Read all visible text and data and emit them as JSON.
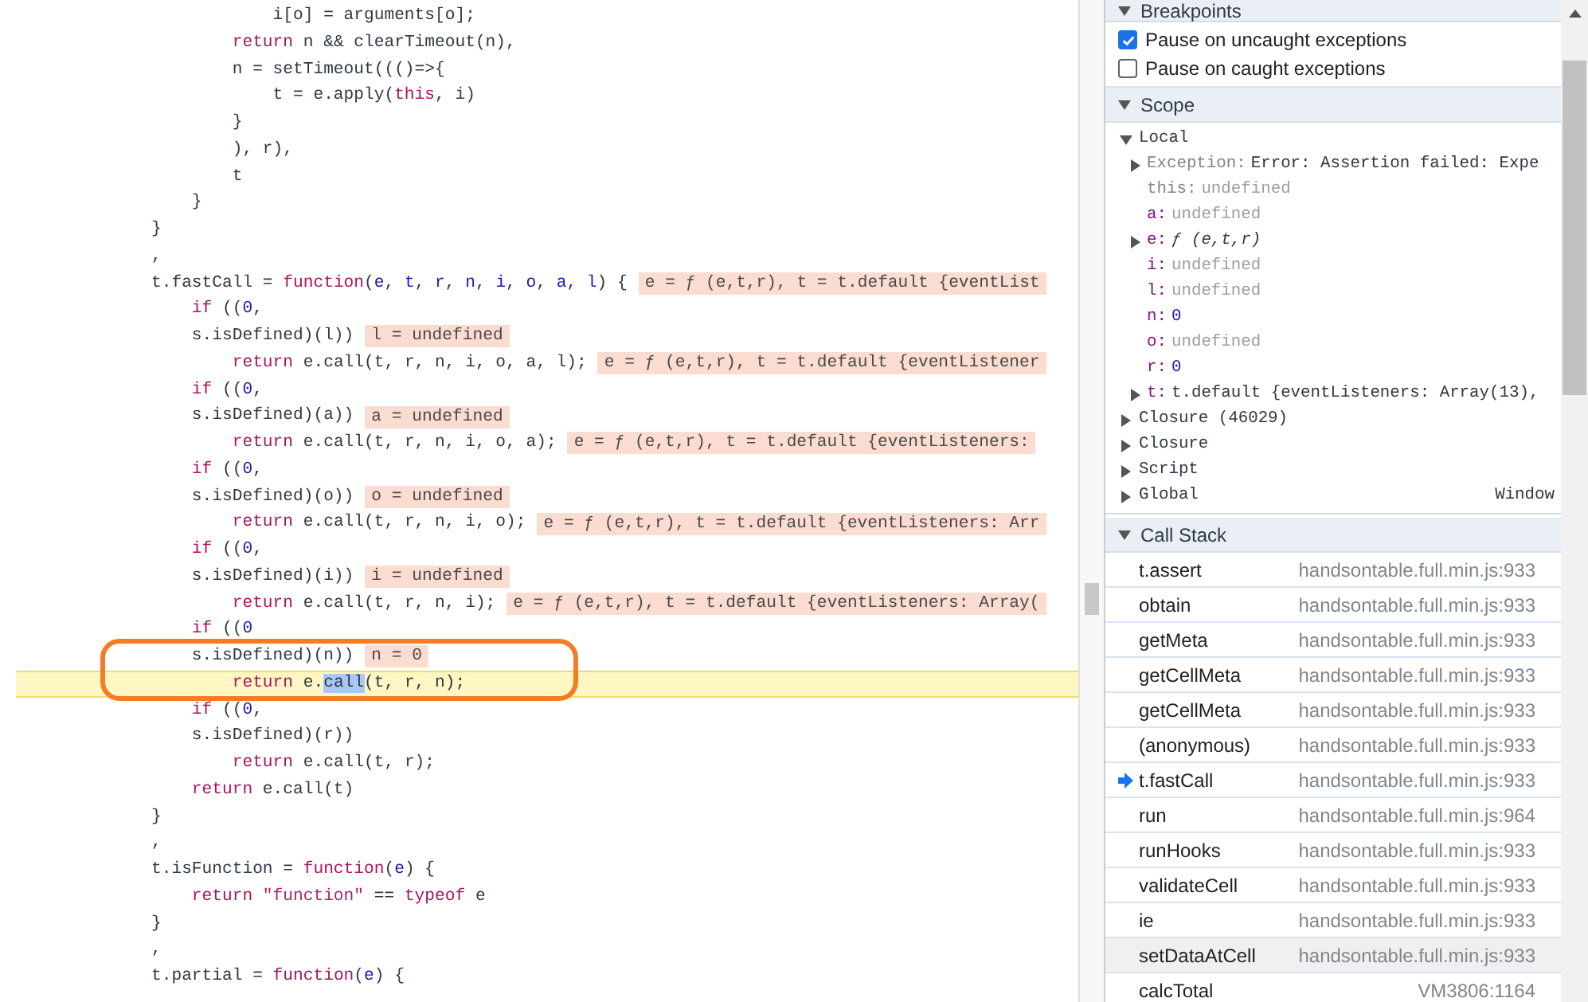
{
  "code": {
    "lines": [
      {
        "segments": [
          {
            "text": "            i[o] = arguments[o];",
            "kind": "plain"
          }
        ]
      },
      {
        "segments": [
          {
            "text": "        return",
            "kind": "keyword"
          },
          {
            "text": " n && clearTimeout(n),",
            "kind": "plain"
          }
        ]
      },
      {
        "segments": [
          {
            "text": "        n = setTimeout((()=>{",
            "kind": "plain"
          }
        ]
      },
      {
        "segments": [
          {
            "text": "            t = e.apply(",
            "kind": "plain"
          },
          {
            "text": "this",
            "kind": "keyword"
          },
          {
            "text": ", i)",
            "kind": "plain"
          }
        ]
      },
      {
        "segments": [
          {
            "text": "        }",
            "kind": "plain"
          }
        ]
      },
      {
        "segments": [
          {
            "text": "        ), r),",
            "kind": "plain"
          }
        ]
      },
      {
        "segments": [
          {
            "text": "        t",
            "kind": "plain"
          }
        ]
      },
      {
        "segments": [
          {
            "text": "    }",
            "kind": "plain"
          }
        ]
      },
      {
        "segments": [
          {
            "text": "}",
            "kind": "plain"
          }
        ]
      },
      {
        "segments": [
          {
            "text": ",",
            "kind": "plain"
          }
        ]
      },
      {
        "segments": [
          {
            "text": "t.fastCall = ",
            "kind": "plain"
          },
          {
            "text": "function",
            "kind": "keyword"
          },
          {
            "text": "(",
            "kind": "plain"
          },
          {
            "text": "e",
            "kind": "param"
          },
          {
            "text": ", ",
            "kind": "plain"
          },
          {
            "text": "t",
            "kind": "param"
          },
          {
            "text": ", ",
            "kind": "plain"
          },
          {
            "text": "r",
            "kind": "param"
          },
          {
            "text": ", ",
            "kind": "plain"
          },
          {
            "text": "n",
            "kind": "param"
          },
          {
            "text": ", ",
            "kind": "plain"
          },
          {
            "text": "i",
            "kind": "param"
          },
          {
            "text": ", ",
            "kind": "plain"
          },
          {
            "text": "o",
            "kind": "param"
          },
          {
            "text": ", ",
            "kind": "plain"
          },
          {
            "text": "a",
            "kind": "param"
          },
          {
            "text": ", ",
            "kind": "plain"
          },
          {
            "text": "l",
            "kind": "param"
          },
          {
            "text": ") {",
            "kind": "plain"
          }
        ],
        "inline_value": "e = ƒ (e,t,r), t = t.default {eventList"
      },
      {
        "segments": [
          {
            "text": "    if",
            "kind": "keyword"
          },
          {
            "text": " ((",
            "kind": "plain"
          },
          {
            "text": "0",
            "kind": "number"
          },
          {
            "text": ",",
            "kind": "plain"
          }
        ]
      },
      {
        "segments": [
          {
            "text": "    s.isDefined)(l))",
            "kind": "plain"
          }
        ],
        "inline_value": "l = undefined"
      },
      {
        "segments": [
          {
            "text": "        return",
            "kind": "keyword"
          },
          {
            "text": " e.call(t, r, n, i, o, a, l);",
            "kind": "plain"
          }
        ],
        "inline_value": "e = ƒ (e,t,r), t = t.default {eventListener"
      },
      {
        "segments": [
          {
            "text": "    if",
            "kind": "keyword"
          },
          {
            "text": " ((",
            "kind": "plain"
          },
          {
            "text": "0",
            "kind": "number"
          },
          {
            "text": ",",
            "kind": "plain"
          }
        ]
      },
      {
        "segments": [
          {
            "text": "    s.isDefined)(a))",
            "kind": "plain"
          }
        ],
        "inline_value": "a = undefined"
      },
      {
        "segments": [
          {
            "text": "        return",
            "kind": "keyword"
          },
          {
            "text": " e.call(t, r, n, i, o, a);",
            "kind": "plain"
          }
        ],
        "inline_value": "e = ƒ (e,t,r), t = t.default {eventListeners:"
      },
      {
        "segments": [
          {
            "text": "    if",
            "kind": "keyword"
          },
          {
            "text": " ((",
            "kind": "plain"
          },
          {
            "text": "0",
            "kind": "number"
          },
          {
            "text": ",",
            "kind": "plain"
          }
        ]
      },
      {
        "segments": [
          {
            "text": "    s.isDefined)(o))",
            "kind": "plain"
          }
        ],
        "inline_value": "o = undefined"
      },
      {
        "segments": [
          {
            "text": "        return",
            "kind": "keyword"
          },
          {
            "text": " e.call(t, r, n, i, o);",
            "kind": "plain"
          }
        ],
        "inline_value": "e = ƒ (e,t,r), t = t.default {eventListeners: Arr"
      },
      {
        "segments": [
          {
            "text": "    if",
            "kind": "keyword"
          },
          {
            "text": " ((",
            "kind": "plain"
          },
          {
            "text": "0",
            "kind": "number"
          },
          {
            "text": ",",
            "kind": "plain"
          }
        ]
      },
      {
        "segments": [
          {
            "text": "    s.isDefined)(i))",
            "kind": "plain"
          }
        ],
        "inline_value": "i = undefined"
      },
      {
        "segments": [
          {
            "text": "        return",
            "kind": "keyword"
          },
          {
            "text": " e.call(t, r, n, i);",
            "kind": "plain"
          }
        ],
        "inline_value": "e = ƒ (e,t,r), t = t.default {eventListeners: Array("
      },
      {
        "segments": [
          {
            "text": "    if",
            "kind": "keyword"
          },
          {
            "text": " ((",
            "kind": "plain"
          },
          {
            "text": "0",
            "kind": "number"
          }
        ]
      },
      {
        "segments": [
          {
            "text": "    s.isDefined)(n))",
            "kind": "plain"
          }
        ],
        "inline_value": "n = 0"
      },
      {
        "current": true,
        "segments": [
          {
            "text": "        return",
            "kind": "keyword"
          },
          {
            "text": " e.",
            "kind": "plain"
          },
          {
            "text": "call",
            "kind": "selection"
          },
          {
            "text": "(t, r, n);",
            "kind": "plain"
          }
        ]
      },
      {
        "segments": [
          {
            "text": "    if",
            "kind": "keyword"
          },
          {
            "text": " ((",
            "kind": "plain"
          },
          {
            "text": "0",
            "kind": "number"
          },
          {
            "text": ",",
            "kind": "plain"
          }
        ]
      },
      {
        "segments": [
          {
            "text": "    s.isDefined)(r))",
            "kind": "plain"
          }
        ]
      },
      {
        "segments": [
          {
            "text": "        return",
            "kind": "keyword"
          },
          {
            "text": " e.call(t, r);",
            "kind": "plain"
          }
        ]
      },
      {
        "segments": [
          {
            "text": "    return",
            "kind": "keyword"
          },
          {
            "text": " e.call(t)",
            "kind": "plain"
          }
        ]
      },
      {
        "segments": [
          {
            "text": "}",
            "kind": "plain"
          }
        ]
      },
      {
        "segments": [
          {
            "text": ",",
            "kind": "plain"
          }
        ]
      },
      {
        "segments": [
          {
            "text": "t.isFunction = ",
            "kind": "plain"
          },
          {
            "text": "function",
            "kind": "keyword"
          },
          {
            "text": "(",
            "kind": "plain"
          },
          {
            "text": "e",
            "kind": "param"
          },
          {
            "text": ") {",
            "kind": "plain"
          }
        ]
      },
      {
        "segments": [
          {
            "text": "    return",
            "kind": "keyword"
          },
          {
            "text": " \"function\"",
            "kind": "string"
          },
          {
            "text": " == ",
            "kind": "plain"
          },
          {
            "text": "typeof",
            "kind": "keyword"
          },
          {
            "text": " e",
            "kind": "plain"
          }
        ]
      },
      {
        "segments": [
          {
            "text": "}",
            "kind": "plain"
          }
        ]
      },
      {
        "segments": [
          {
            "text": ",",
            "kind": "plain"
          }
        ]
      },
      {
        "segments": [
          {
            "text": "t.partial = ",
            "kind": "plain"
          },
          {
            "text": "function",
            "kind": "keyword"
          },
          {
            "text": "(",
            "kind": "plain"
          },
          {
            "text": "e",
            "kind": "param"
          },
          {
            "text": ") {",
            "kind": "plain"
          }
        ]
      }
    ]
  },
  "breakpoints": {
    "title": "Breakpoints",
    "options": [
      {
        "label": "Pause on uncaught exceptions",
        "checked": true
      },
      {
        "label": "Pause on caught exceptions",
        "checked": false
      }
    ]
  },
  "scope": {
    "title": "Scope",
    "items": [
      {
        "name": "Local",
        "expanded": true,
        "children": [
          {
            "name": "Exception:",
            "synthetic": true,
            "value": "Error: Assertion failed: Expe",
            "kind": "object",
            "expandable": true
          },
          {
            "name": "this:",
            "synthetic": true,
            "value": "undefined",
            "kind": "undefined",
            "expandable": false
          },
          {
            "name": "a:",
            "synthetic": false,
            "value": "undefined",
            "kind": "undefined",
            "expandable": false
          },
          {
            "name": "e:",
            "synthetic": false,
            "value": "ƒ (e,t,r)",
            "kind": "function",
            "expandable": true
          },
          {
            "name": "i:",
            "synthetic": false,
            "value": "undefined",
            "kind": "undefined",
            "expandable": false
          },
          {
            "name": "l:",
            "synthetic": false,
            "value": "undefined",
            "kind": "undefined",
            "expandable": false
          },
          {
            "name": "n:",
            "synthetic": false,
            "value": "0",
            "kind": "number",
            "expandable": false
          },
          {
            "name": "o:",
            "synthetic": false,
            "value": "undefined",
            "kind": "undefined",
            "expandable": false
          },
          {
            "name": "r:",
            "synthetic": false,
            "value": "0",
            "kind": "number",
            "expandable": false
          },
          {
            "name": "t:",
            "synthetic": false,
            "value": "t.default {eventListeners: Array(13),",
            "kind": "object",
            "expandable": true
          }
        ]
      },
      {
        "name": "Closure (46029)",
        "expanded": false
      },
      {
        "name": "Closure",
        "expanded": false
      },
      {
        "name": "Script",
        "expanded": false
      },
      {
        "name": "Global",
        "expanded": false,
        "value": "Window"
      }
    ]
  },
  "call_stack": {
    "title": "Call Stack",
    "frames": [
      {
        "name": "t.assert",
        "location": "handsontable.full.min.js:933",
        "selected": false,
        "hovered": false
      },
      {
        "name": "obtain",
        "location": "handsontable.full.min.js:933",
        "selected": false,
        "hovered": false
      },
      {
        "name": "getMeta",
        "location": "handsontable.full.min.js:933",
        "selected": false,
        "hovered": false
      },
      {
        "name": "getCellMeta",
        "location": "handsontable.full.min.js:933",
        "selected": false,
        "hovered": false
      },
      {
        "name": "getCellMeta",
        "location": "handsontable.full.min.js:933",
        "selected": false,
        "hovered": false
      },
      {
        "name": "(anonymous)",
        "location": "handsontable.full.min.js:933",
        "selected": false,
        "hovered": false
      },
      {
        "name": "t.fastCall",
        "location": "handsontable.full.min.js:933",
        "selected": true,
        "hovered": false
      },
      {
        "name": "run",
        "location": "handsontable.full.min.js:964",
        "selected": false,
        "hovered": false
      },
      {
        "name": "runHooks",
        "location": "handsontable.full.min.js:933",
        "selected": false,
        "hovered": false
      },
      {
        "name": "validateCell",
        "location": "handsontable.full.min.js:933",
        "selected": false,
        "hovered": false
      },
      {
        "name": "ie",
        "location": "handsontable.full.min.js:933",
        "selected": false,
        "hovered": false
      },
      {
        "name": "setDataAtCell",
        "location": "handsontable.full.min.js:933",
        "selected": false,
        "hovered": true
      },
      {
        "name": "calcTotal",
        "location": "VM3806:1164",
        "selected": false,
        "hovered": false
      }
    ]
  }
}
